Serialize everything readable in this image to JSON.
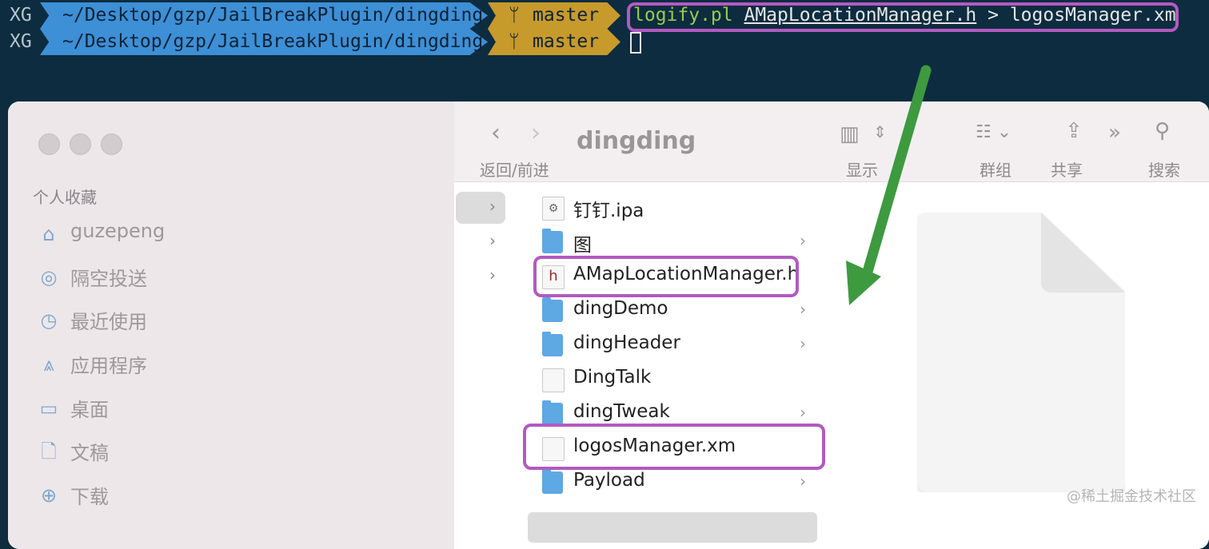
{
  "terminal": {
    "lines": [
      {
        "host": "XG",
        "path": "~/Desktop/gzp/JailBreakPlugin/dingding",
        "branch": "master",
        "command_tool": "logify.pl",
        "command_arg": "AMapLocationManager.h",
        "command_rest": "> logosManager.xm"
      },
      {
        "host": "XG",
        "path": "~/Desktop/gzp/JailBreakPlugin/dingding",
        "branch": "master"
      }
    ],
    "branch_icon": "git-branch-icon"
  },
  "finder": {
    "title": "dingding",
    "toolbar": {
      "nav_label": "返回/前进",
      "view_label": "显示",
      "group_label": "群组",
      "share_label": "共享",
      "search_label": "搜索"
    },
    "sidebar": {
      "section_title": "个人收藏",
      "items": [
        {
          "label": "guzepeng",
          "icon": "home-icon"
        },
        {
          "label": "隔空投送",
          "icon": "airdrop-icon"
        },
        {
          "label": "最近使用",
          "icon": "clock-icon"
        },
        {
          "label": "应用程序",
          "icon": "applications-icon"
        },
        {
          "label": "桌面",
          "icon": "desktop-icon"
        },
        {
          "label": "文稿",
          "icon": "document-icon"
        },
        {
          "label": "下载",
          "icon": "download-icon"
        }
      ]
    },
    "files": [
      {
        "name": "钉钉.ipa",
        "kind": "ipa",
        "has_children": false
      },
      {
        "name": "图",
        "kind": "folder",
        "has_children": true
      },
      {
        "name": "AMapLocationManager.h",
        "kind": "header",
        "has_children": false
      },
      {
        "name": "dingDemo",
        "kind": "folder",
        "has_children": true
      },
      {
        "name": "dingHeader",
        "kind": "folder",
        "has_children": true
      },
      {
        "name": "DingTalk",
        "kind": "doc",
        "has_children": false
      },
      {
        "name": "dingTweak",
        "kind": "folder",
        "has_children": true
      },
      {
        "name": "logosManager.xm",
        "kind": "doc",
        "has_children": false,
        "selected": true
      },
      {
        "name": "Payload",
        "kind": "folder",
        "has_children": true
      }
    ]
  },
  "watermark": "@稀土掘金技术社区",
  "colors": {
    "highlight": "#b25ac0",
    "arrow": "#3d9a3f",
    "terminal_bg": "#0d2c40"
  }
}
